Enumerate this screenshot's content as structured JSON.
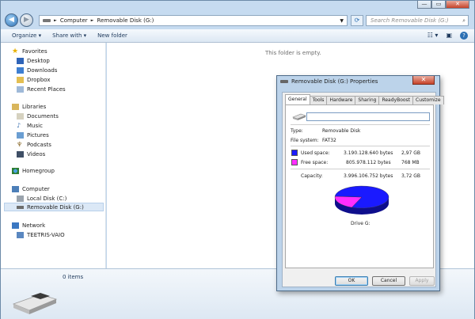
{
  "titlebar": {
    "min_glyph": "—",
    "max_glyph": "▭",
    "close_glyph": "✕"
  },
  "address": {
    "crumbs": [
      "Computer",
      "Removable Disk (G:)"
    ],
    "separator": "►",
    "search_placeholder": "Search Removable Disk (G:)"
  },
  "toolbar": {
    "organize": "Organize ▾",
    "share_with": "Share with ▾",
    "new_folder": "New folder"
  },
  "sidebar": {
    "favorites": {
      "label": "Favorites",
      "items": [
        "Desktop",
        "Downloads",
        "Dropbox",
        "Recent Places"
      ]
    },
    "libraries": {
      "label": "Libraries",
      "items": [
        "Documents",
        "Music",
        "Pictures",
        "Podcasts",
        "Videos"
      ]
    },
    "homegroup": "Homegroup",
    "computer": {
      "label": "Computer",
      "items": [
        "Local Disk (C:)",
        "Removable Disk (G:)"
      ]
    },
    "network": {
      "label": "Network",
      "items": [
        "TEETRIS-VAIO"
      ]
    }
  },
  "content": {
    "empty_message": "This folder is empty."
  },
  "details": {
    "item_count": "0 items"
  },
  "dialog": {
    "title": "Removable Disk (G:) Properties",
    "tabs": [
      "General",
      "Tools",
      "Hardware",
      "Sharing",
      "ReadyBoost",
      "Customize"
    ],
    "name_value": "",
    "type_label": "Type:",
    "type_value": "Removable Disk",
    "fs_label": "File system:",
    "fs_value": "FAT32",
    "used_label": "Used space:",
    "used_bytes": "3.190.128.640 bytes",
    "used_size": "2,97 GB",
    "free_label": "Free space:",
    "free_bytes": "805.978.112 bytes",
    "free_size": "768 MB",
    "capacity_label": "Capacity:",
    "capacity_bytes": "3.996.106.752 bytes",
    "capacity_size": "3,72 GB",
    "drive_label": "Drive G:",
    "used_fraction": 0.798,
    "used_color": "#1a1aff",
    "free_color": "#ff2dff",
    "ok": "OK",
    "cancel": "Cancel",
    "apply": "Apply"
  }
}
